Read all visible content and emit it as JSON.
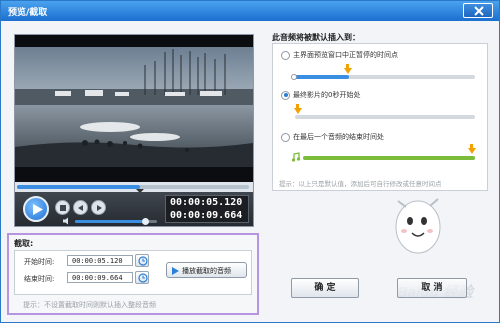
{
  "window": {
    "title": "预览/截取"
  },
  "player": {
    "time_current": "00:00:05.120",
    "time_total": "00:00:09.664",
    "progress": 0.53,
    "volume": 0.85
  },
  "crop": {
    "section_title": "截取:",
    "start_label": "开始时间:",
    "start_value": "00:00:05.120",
    "end_label": "结束时间:",
    "end_value": "00:00:09.664",
    "play_button_label": "播放截取的音频",
    "tip": "提示：不设置截取时间则默认插入整段音频"
  },
  "insert_panel": {
    "title": "此音频将被默认插入到：",
    "options": [
      {
        "label": "主界面预览窗口中正暂停的时间点",
        "selected": false
      },
      {
        "label": "最终影片的0秒开始处",
        "selected": true
      },
      {
        "label": "在最后一个音频的结束时间处",
        "selected": false
      }
    ],
    "tip": "提示：以上只是默认值，添加后可自行修改或任意时间点"
  },
  "buttons": {
    "ok_label": "确 定",
    "cancel_label": "取 消"
  },
  "watermark": "Baidu 经验",
  "colors": {
    "titlebar": "#1b6fd0",
    "accent_blue": "#3b8fe2",
    "marker_orange": "#f2a100",
    "track_green": "#7bbd3a",
    "crop_border": "#b794e0"
  }
}
